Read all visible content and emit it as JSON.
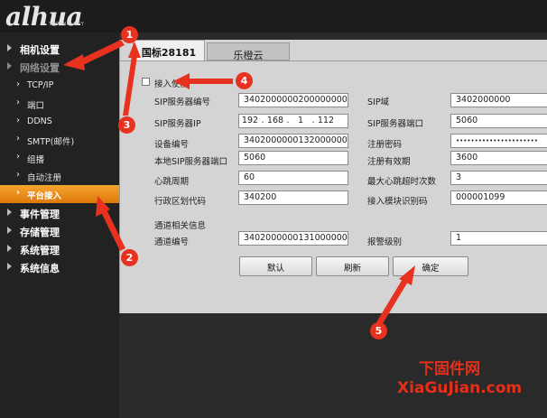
{
  "logo": {
    "text": "alhua",
    "sub": "TECHNOLOGY"
  },
  "sidebar": {
    "items": [
      {
        "label": "相机设置"
      },
      {
        "label": "网络设置"
      },
      {
        "label": "事件管理"
      },
      {
        "label": "存储管理"
      },
      {
        "label": "系统管理"
      },
      {
        "label": "系统信息"
      }
    ],
    "network_sub": [
      {
        "label": "TCP/IP"
      },
      {
        "label": "端口"
      },
      {
        "label": "DDNS"
      },
      {
        "label": "SMTP(邮件)"
      },
      {
        "label": "组播"
      },
      {
        "label": "自动注册"
      },
      {
        "label": "平台接入"
      }
    ]
  },
  "tabs": [
    {
      "label": "国标28181"
    },
    {
      "label": "乐橙云"
    }
  ],
  "form": {
    "enable_label": "接入使能",
    "sip_server_id": {
      "label": "SIP服务器编号",
      "value": "34020000002000000001"
    },
    "sip_domain": {
      "label": "SIP域",
      "value": "3402000000"
    },
    "sip_server_ip": {
      "label": "SIP服务器IP",
      "ip": [
        "192",
        "168",
        "1",
        "112"
      ]
    },
    "sip_server_port": {
      "label": "SIP服务器端口",
      "value": "5060"
    },
    "device_id": {
      "label": "设备编号",
      "value": "34020000001320000001"
    },
    "register_password": {
      "label": "注册密码",
      "value": "••••••••••••••••••••••"
    },
    "local_sip_port": {
      "label": "本地SIP服务器端口",
      "value": "5060"
    },
    "register_validity": {
      "label": "注册有效期",
      "value": "3600"
    },
    "heartbeat_period": {
      "label": "心跳周期",
      "value": "60"
    },
    "max_heartbeat_timeouts": {
      "label": "最大心跳超时次数",
      "value": "3"
    },
    "region_code": {
      "label": "行政区划代码",
      "value": "340200"
    },
    "module_id": {
      "label": "接入模块识别码",
      "value": "000001099"
    },
    "channel_section_title": "通道相关信息",
    "channel_id": {
      "label": "通道编号",
      "value": "34020000001310000001"
    },
    "alarm_level": {
      "label": "报警级别",
      "value": "1"
    }
  },
  "buttons": {
    "default": "默认",
    "refresh": "刷新",
    "confirm": "确定"
  },
  "annotations": [
    "1",
    "2",
    "3",
    "4",
    "5"
  ],
  "watermark": {
    "cn": "下固件网",
    "url": "XiaGuJian.com"
  },
  "colors": {
    "accent": "#f0901f",
    "annotation": "#e8321f"
  }
}
